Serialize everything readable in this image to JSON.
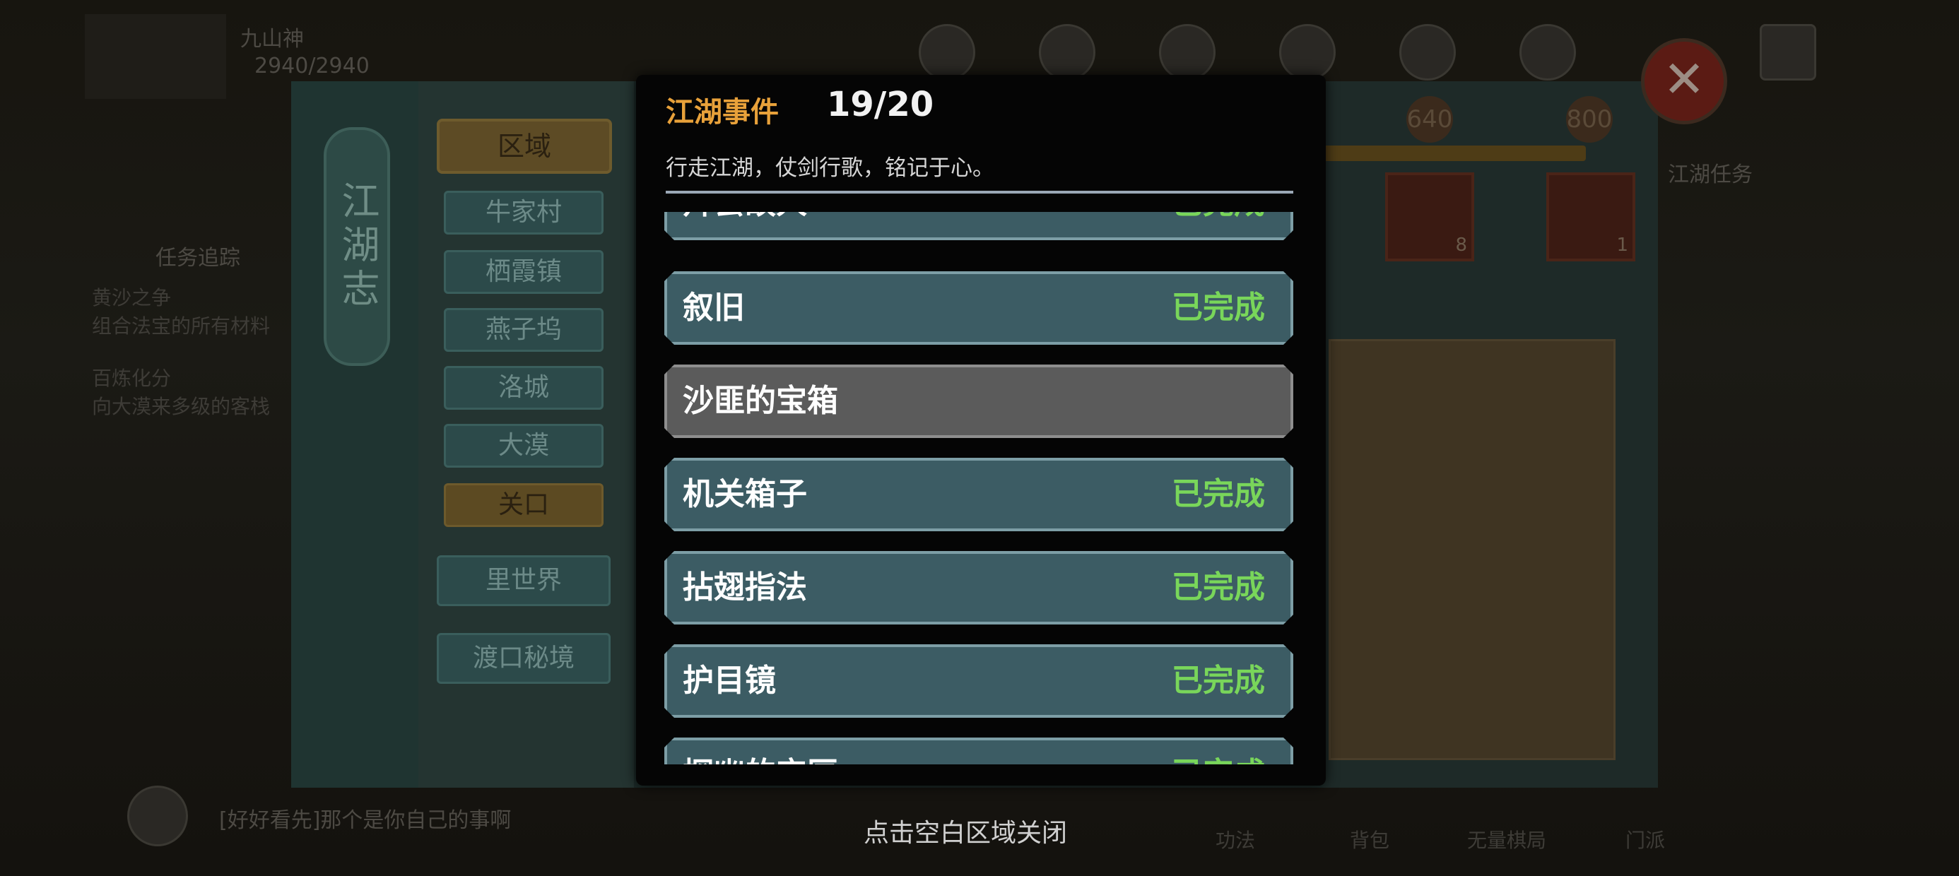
{
  "background": {
    "player_name": "九山神",
    "hp": "2940/2940",
    "quest_tracker_title": "任务追踪",
    "quest_1_title": "黄沙之争",
    "quest_1_desc": "组合法宝的所有材料",
    "quest_2_title": "百炼化分",
    "quest_2_desc": "向大漠来多级的客栈",
    "chat_message": "[好好看先]那个是你自己的事啊",
    "right_quest_label": "江湖任务",
    "bottom_labels": [
      "功法",
      "背包",
      "无量棋局",
      "门派"
    ]
  },
  "journal": {
    "title": "江湖志",
    "region_header": "区域",
    "regions": [
      {
        "label": "牛家村",
        "selected": false
      },
      {
        "label": "栖霞镇",
        "selected": false
      },
      {
        "label": "燕子坞",
        "selected": false
      },
      {
        "label": "洛城",
        "selected": false
      },
      {
        "label": "大漠",
        "selected": false
      },
      {
        "label": "关口",
        "selected": true
      }
    ],
    "other_worlds": [
      "里世界",
      "渡口秘境"
    ],
    "score_marks": [
      "640",
      "800"
    ],
    "reward_counts": [
      "8",
      "1"
    ]
  },
  "popup": {
    "title": "江湖事件",
    "count": "19/20",
    "description": "行走江湖，仗剑行歌，铭记于心。",
    "events": [
      {
        "name": "拜会故人",
        "status": "已完成",
        "completed": true
      },
      {
        "name": "叙旧",
        "status": "已完成",
        "completed": true
      },
      {
        "name": "沙匪的宝箱",
        "status": "",
        "completed": false
      },
      {
        "name": "机关箱子",
        "status": "已完成",
        "completed": true
      },
      {
        "name": "拈翅指法",
        "status": "已完成",
        "completed": true
      },
      {
        "name": "护目镜",
        "status": "已完成",
        "completed": true
      },
      {
        "name": "探幽的宝匣",
        "status": "已完成",
        "completed": true
      }
    ]
  },
  "close_hint": "点击空白区域关闭",
  "colors": {
    "title_accent": "#e8a13a",
    "completed_status": "#79d65a",
    "row_completed": "#3c5c64",
    "row_pending": "#5b5b5b"
  },
  "icons": [
    "close-icon"
  ]
}
